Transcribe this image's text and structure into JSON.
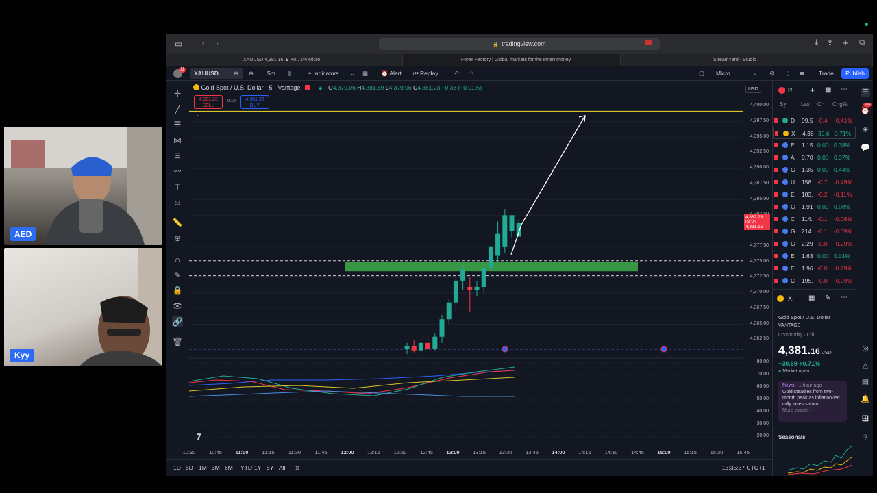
{
  "cams": [
    {
      "name": "AED"
    },
    {
      "name": "Kyy"
    }
  ],
  "browser": {
    "url": "tradingview.com",
    "tabs": [
      "XAUUSD 4,381.16 ▲ +0.71% Micro",
      "Forex Factory | Global markets for the smart money.",
      "StreamYard - Studio"
    ]
  },
  "toolbar": {
    "badge": "11",
    "symbol": "XAUUSD",
    "interval": "5m",
    "indicators": "Indicators",
    "alert": "Alert",
    "replay": "Replay",
    "micro": "Micro",
    "trade": "Trade",
    "publish": "Publish"
  },
  "legend": {
    "title": "Gold Spot / U.S. Dollar · 5 · Vantage",
    "o_label": "O",
    "o": "4,379.06",
    "h_label": "H",
    "h": "4,381.89",
    "l_label": "L",
    "l": "4,379.06",
    "c_label": "C",
    "c": "4,381.23",
    "change": "−0.38 (−0.01%)",
    "sell_price": "4,381.23",
    "sell_label": "SELL",
    "spread": "0.10",
    "buy_price": "4,381.33",
    "buy_label": "BUY"
  },
  "currency": "USD",
  "price_axis": [
    "4,400.00",
    "4,397.50",
    "4,395.00",
    "4,392.50",
    "4,390.00",
    "4,387.50",
    "4,385.00",
    "4,382.50",
    "4,377.50",
    "4,375.00",
    "4,372.50",
    "4,370.00",
    "4,367.50",
    "4,365.00",
    "4,362.50"
  ],
  "price_label": {
    "a": "4,382.23",
    "b": "04:23",
    "c": "4,381.16"
  },
  "osc_axis": [
    "80.00",
    "70.00",
    "60.00",
    "50.00",
    "40.00",
    "30.00",
    "20.00"
  ],
  "time_axis": [
    "10:30",
    "10:45",
    "11:00",
    "11:15",
    "11:30",
    "11:45",
    "12:00",
    "12:15",
    "12:30",
    "12:45",
    "13:00",
    "13:15",
    "13:30",
    "13:45",
    "14:00",
    "14:15",
    "14:30",
    "14:45",
    "15:00",
    "15:15",
    "15:30",
    "15:45"
  ],
  "ranges": [
    "1D",
    "5D",
    "1M",
    "3M",
    "6M",
    "YTD",
    "1Y",
    "5Y",
    "All"
  ],
  "clock": "13:35:37 UTC+1",
  "chart_data": {
    "type": "candlestick",
    "title": "Gold Spot / U.S. Dollar · 5 · Vantage",
    "ylim": [
      4360,
      4402
    ],
    "candles": [
      {
        "o": 4361.0,
        "h": 4362.0,
        "l": 4360.2,
        "c": 4361.5,
        "t": "12:25"
      },
      {
        "o": 4361.5,
        "h": 4362.5,
        "l": 4360.5,
        "c": 4360.8,
        "t": "12:30"
      },
      {
        "o": 4360.8,
        "h": 4362.3,
        "l": 4360.5,
        "c": 4362.0,
        "t": "12:35"
      },
      {
        "o": 4362.0,
        "h": 4363.0,
        "l": 4360.8,
        "c": 4361.0,
        "t": "12:40"
      },
      {
        "o": 4361.0,
        "h": 4363.5,
        "l": 4360.8,
        "c": 4363.0,
        "t": "12:45"
      },
      {
        "o": 4363.0,
        "h": 4366.5,
        "l": 4362.0,
        "c": 4365.8,
        "t": "12:50"
      },
      {
        "o": 4365.8,
        "h": 4369.0,
        "l": 4365.0,
        "c": 4368.5,
        "t": "12:55"
      },
      {
        "o": 4368.5,
        "h": 4373.0,
        "l": 4367.5,
        "c": 4372.0,
        "t": "13:00"
      },
      {
        "o": 4372.0,
        "h": 4374.5,
        "l": 4370.5,
        "c": 4373.8,
        "t": "13:05"
      },
      {
        "o": 4371.0,
        "h": 4372.5,
        "l": 4367.0,
        "c": 4370.5,
        "t": "13:10"
      },
      {
        "o": 4370.5,
        "h": 4372.0,
        "l": 4369.5,
        "c": 4371.0,
        "t": "13:15"
      },
      {
        "o": 4371.0,
        "h": 4374.5,
        "l": 4370.0,
        "c": 4374.0,
        "t": "13:20"
      },
      {
        "o": 4374.0,
        "h": 4378.0,
        "l": 4373.0,
        "c": 4377.5,
        "t": "13:25"
      },
      {
        "o": 4376.0,
        "h": 4381.5,
        "l": 4375.0,
        "c": 4379.5,
        "t": "13:30"
      },
      {
        "o": 4377.5,
        "h": 4383.5,
        "l": 4376.5,
        "c": 4382.5,
        "t": "13:30"
      },
      {
        "o": 4380.0,
        "h": 4382.5,
        "l": 4379.0,
        "c": 4382.5,
        "t": "13:35"
      },
      {
        "o": 4379.06,
        "h": 4381.89,
        "l": 4379.06,
        "c": 4381.23,
        "t": "13:35"
      }
    ],
    "hline": 4399.2,
    "zone": [
      4373.5,
      4375.0
    ],
    "dashed_levels": [
      4375.2,
      4372.8,
      4361.0
    ],
    "arrow": {
      "from": [
        13.37,
        4376.5
      ],
      "via": [
        13.35,
        4381.0
      ],
      "to": [
        13.53,
        4398.5
      ]
    }
  },
  "watchlist": {
    "header": "R",
    "cols": [
      "Syı",
      "Las",
      "Ch",
      "Chg%"
    ],
    "rows": [
      {
        "s": "D",
        "last": "99.5",
        "ch": "-0.4",
        "pct": "-0.41%",
        "dir": "neg",
        "color": "#22ab94"
      },
      {
        "s": "X",
        "last": "4,38",
        "ch": "30.6",
        "pct": "0.71%",
        "dir": "pos",
        "color": "#f0b90b"
      },
      {
        "s": "E",
        "last": "1.15",
        "ch": "0.00",
        "pct": "0.38%",
        "dir": "pos",
        "color": "#4a7cf0"
      },
      {
        "s": "A",
        "last": "0.70",
        "ch": "0.00",
        "pct": "0.37%",
        "dir": "pos",
        "color": "#4a7cf0"
      },
      {
        "s": "G",
        "last": "1.35",
        "ch": "0.00",
        "pct": "0.44%",
        "dir": "pos",
        "color": "#4a7cf0"
      },
      {
        "s": "U",
        "last": "158.",
        "ch": "-0.7",
        "pct": "-0.49%",
        "dir": "neg",
        "color": "#4a7cf0"
      },
      {
        "s": "E",
        "last": "183.",
        "ch": "-0.2",
        "pct": "-0.11%",
        "dir": "neg",
        "color": "#4a7cf0"
      },
      {
        "s": "G",
        "last": "1.91",
        "ch": "0.00",
        "pct": "0.08%",
        "dir": "pos",
        "color": "#4a7cf0"
      },
      {
        "s": "C",
        "last": "114.",
        "ch": "-0.1",
        "pct": "-0.08%",
        "dir": "neg",
        "color": "#4a7cf0"
      },
      {
        "s": "G",
        "last": "214.",
        "ch": "-0.1",
        "pct": "-0.09%",
        "dir": "neg",
        "color": "#4a7cf0"
      },
      {
        "s": "G",
        "last": "2.29",
        "ch": "-0.0",
        "pct": "-0.29%",
        "dir": "neg",
        "color": "#4a7cf0"
      },
      {
        "s": "E",
        "last": "1.63",
        "ch": "0.00",
        "pct": "0.01%",
        "dir": "pos",
        "color": "#4a7cf0"
      },
      {
        "s": "E",
        "last": "1.96",
        "ch": "-0.0",
        "pct": "-0.29%",
        "dir": "neg",
        "color": "#4a7cf0"
      },
      {
        "s": "C",
        "last": "195.",
        "ch": "-0.0",
        "pct": "-0.09%",
        "dir": "neg",
        "color": "#4a7cf0"
      }
    ]
  },
  "details": {
    "sym": "X.",
    "name": "Gold Spot / U.S. Dollar",
    "broker": "VANTAGE",
    "type": "Commodity · Cfd",
    "price_main": "4,381.",
    "price_dec": "16",
    "price_cur": "USD",
    "change": "+30.69 +0.71%",
    "status": "Market open",
    "news_tag": "News",
    "news_time": "· 1 hour ago",
    "news_text": "Gold steadies from two-month peak as inflation-led rally loses steam",
    "more": "More events ›",
    "seasonals": "Seasonals"
  },
  "icons": {
    "alerts_badge": "99+"
  }
}
